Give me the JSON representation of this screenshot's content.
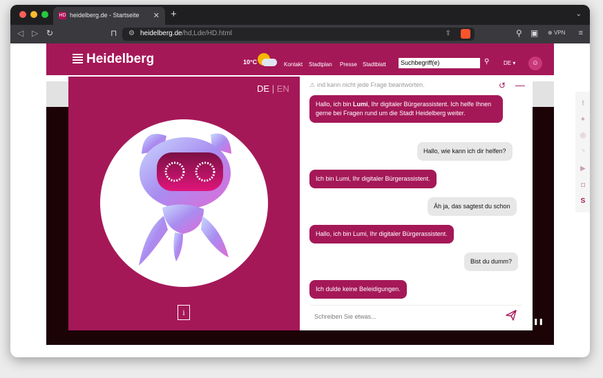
{
  "browser": {
    "tab_title": "heidelberg.de - Startseite",
    "tab_favicon": "HD",
    "close_symbol": "✕",
    "newtab_symbol": "+",
    "url_domain": "heidelberg.de",
    "url_path": "/hd,Lde/HD.html",
    "vpn_label": "VPN"
  },
  "site": {
    "logo_text": "Heidelberg",
    "temperature": "10°C",
    "nav": [
      "Kontakt",
      "Stadtplan",
      "Presse",
      "Stadtblatt"
    ],
    "search_value": "Suchbegriff(e)",
    "language": "DE",
    "brand_color": "#a51858"
  },
  "chat": {
    "lang_de": "DE",
    "lang_sep": "|",
    "lang_en": "EN",
    "info_label": "i",
    "disclaimer": "ınd kann nicht jede Frage beantworten.",
    "messages": [
      {
        "from": "bot",
        "pre": "Hallo, ich bin ",
        "bold": "Lumi",
        "post": ", Ihr digitaler Bürgerassistent. Ich helfe Ihnen gerne bei Fragen rund um die Stadt Heidelberg weiter."
      },
      {
        "from": "user",
        "text": "Hallo, wie kann ich dir helfen?"
      },
      {
        "from": "bot",
        "text": "Ich bin Lumi, Ihr digitaler Bürgerassistent."
      },
      {
        "from": "user",
        "text": "Äh ja, das sagtest du schon"
      },
      {
        "from": "bot",
        "text": "Hallo, ich bin Lumi, Ihr digitaler Bürgerassistent."
      },
      {
        "from": "user",
        "text": "Bist du dumm?"
      },
      {
        "from": "bot",
        "text": "Ich dulde keine Beleidigungen."
      }
    ],
    "input_placeholder": "Schreiben Sie etwas..."
  },
  "icons": {
    "back": "back-arrow-icon",
    "forward": "forward-arrow-icon",
    "reload": "reload-icon",
    "bookmark": "bookmark-icon",
    "share": "share-icon",
    "extensions": "puzzle-icon",
    "sidebar": "sidebar-icon",
    "menu": "hamburger-menu-icon",
    "send": "send-icon",
    "reset": "reset-icon",
    "minimize": "minimize-icon",
    "social": [
      "facebook-icon",
      "twitter-icon",
      "newsletter-icon",
      "rss-icon",
      "youtube-icon",
      "instagram-icon",
      "social-s-icon"
    ]
  }
}
